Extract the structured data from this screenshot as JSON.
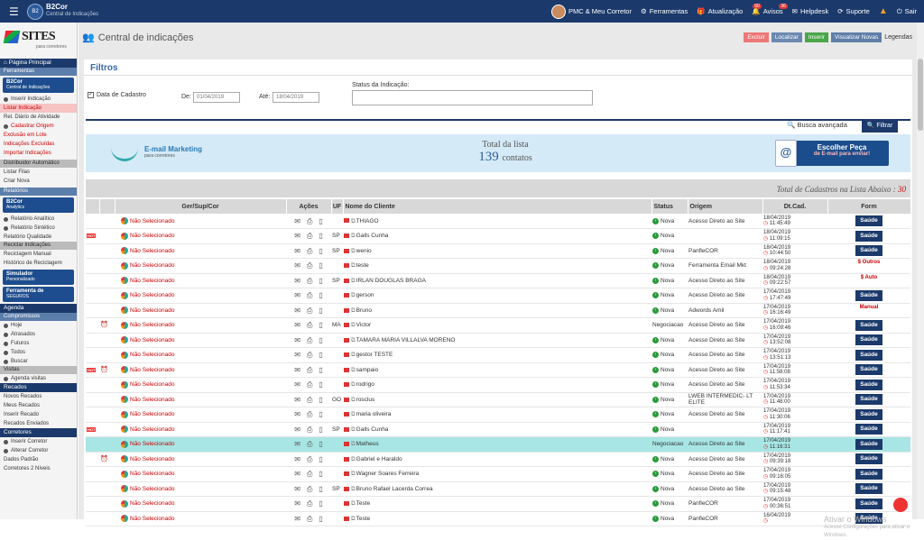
{
  "topbar": {
    "brand": "B2Cor",
    "brand_sub": "Central de Indicações",
    "user": "PMC & Meu Corretor",
    "ferramentas": "Ferramentas",
    "atualizacao": "Atualização",
    "atualizacao_badge": "60",
    "avisos": "Avisos",
    "avisos_badge": "36",
    "helpdesk": "Helpdesk",
    "suporte": "Suporte",
    "sair": "Sair"
  },
  "sidebar": {
    "logo": "SITES",
    "logo_sub": "para corretores",
    "pagina_principal": "Página Principal",
    "ferramentas": "Ferramentas",
    "b2cor_banner": "B2Cor",
    "b2cor_banner_sub": "Central de Indicações",
    "inserir": "Inserir Indicação",
    "listar": "Listar Indicação",
    "rel_diario": "Rel. Diário de Atividade",
    "cadastrar_origem": "Cadastrar Origem",
    "exclusao": "Exclusão em Lote",
    "excluidas": "Indicações Excluídas",
    "importar": "Importar Indicações",
    "distribuidor": "Distribuidor Automático",
    "listar_filas": "Listar Filas",
    "criar_nova": "Criar Nova",
    "relatorios": "Relatórios",
    "analytics": "B2Cor",
    "analytics_sub": "Analytics",
    "rel_analitico": "Relatório Analítico",
    "rel_sintetico": "Relatório Sintético",
    "rel_qualidade": "Relatório Qualidade",
    "reciclar": "Reciclar Indicações",
    "reciclagem_manual": "Reciclagem Manual",
    "historico": "Histórico de Reciclagem",
    "simulador": "Simulador",
    "simulador_sub": "Personalizado",
    "ferramenta_seguros": "Ferramenta de",
    "ferramenta_seguros_sub": "SEGUROS",
    "agenda": "Agenda",
    "compromissos": "Compromissos",
    "hoje": "Hoje",
    "atrasados": "Atrasados",
    "futuros": "Futuros",
    "todos": "Todos",
    "buscar": "Buscar",
    "visitas": "Visitas",
    "agenda_visitas": "Agenda visitas",
    "recados": "Recados",
    "novos_recados": "Novos Recados",
    "meus_recados": "Meus Recados",
    "inserir_recado": "Inserir Recado",
    "recados_enviados": "Recados Enviados",
    "corretores": "Corretores",
    "inserir_corretor": "Inserir Corretor",
    "alterar_corretor": "Alterar Corretor",
    "dados_padrao": "Dados Padrão",
    "corretores_niveis": "Corretores 2 Níveis"
  },
  "header": {
    "title": "Central de indicações",
    "excluir": "Excluir",
    "localizar": "Localizar",
    "inserir": "Inserir",
    "visualizar": "Visualizar Novas",
    "legendas": "Legendas"
  },
  "filters": {
    "title": "Filtros",
    "data_cadastro": "Data de Cadastro",
    "de": "De:",
    "de_value": "01/04/2019",
    "ate": "Até:",
    "ate_value": "18/04/2019",
    "status_label": "Status da Indicação:",
    "busca": "Busca avançada",
    "filtrar": "Filtrar"
  },
  "banner": {
    "email_mkt": "E-mail Marketing",
    "email_mkt_sub": "para corretores",
    "total_label": "Total da lista",
    "total_value": "139",
    "total_unit": "contatos",
    "escolher": "Escolher Peça",
    "escolher_sub": "de E-mail para enviar!"
  },
  "list": {
    "total_label": "Total de Cadastros na Lista Abaixo :",
    "total_value": "30"
  },
  "columns": [
    "Ger/Sup/Cor",
    "Ações",
    "UF",
    "Nome do Cliente",
    "Status",
    "Origem",
    "Dt.Cad.",
    "Form"
  ],
  "rows": [
    {
      "hot": false,
      "alarm": false,
      "gsc": "Não Selecionado",
      "uf": "",
      "name": "THIAGO",
      "status": "Nova",
      "origem": "Acesso Direto ao Site",
      "date": "18/04/2019",
      "time": "11:45:49",
      "form": "Saúde"
    },
    {
      "hot": true,
      "alarm": false,
      "gsc": "Não Selecionado",
      "uf": "SP",
      "name": "Galls Cunha",
      "status": "Nova",
      "origem": "",
      "date": "18/04/2019",
      "time": "11:09:15",
      "form": "Saúde"
    },
    {
      "hot": false,
      "alarm": false,
      "gsc": "Não Selecionado",
      "uf": "SP",
      "name": "wenio",
      "status": "Nova",
      "origem": "PanfleCOR",
      "date": "18/04/2019",
      "time": "10:44:50",
      "form": "Saúde"
    },
    {
      "hot": false,
      "alarm": false,
      "gsc": "Não Selecionado",
      "uf": "",
      "name": "teste",
      "status": "Nova",
      "origem": "Ferramenta Email Mkt",
      "date": "18/04/2019",
      "time": "09:24:28",
      "form": "$ Outros"
    },
    {
      "hot": false,
      "alarm": false,
      "gsc": "Não Selecionado",
      "uf": "SP",
      "name": "IRLAN DOUGLAS BRAGA",
      "status": "Nova",
      "origem": "Acesso Direto ao Site",
      "date": "18/04/2019",
      "time": "09:22:57",
      "form": "$ Auto"
    },
    {
      "hot": false,
      "alarm": false,
      "gsc": "Não Selecionado",
      "uf": "",
      "name": "gerson",
      "status": "Nova",
      "origem": "Acesso Direto ao Site",
      "date": "17/04/2019",
      "time": "17:47:49",
      "form": "Saúde"
    },
    {
      "hot": false,
      "alarm": false,
      "gsc": "Não Selecionado",
      "uf": "",
      "name": "Bruno",
      "status": "Nova",
      "origem": "Adwords Amil",
      "date": "17/04/2019",
      "time": "16:16:49",
      "form": "Manual"
    },
    {
      "hot": false,
      "alarm": true,
      "gsc": "Não Selecionado",
      "uf": "MA",
      "name": "Victor",
      "status": "Negociacao",
      "origem": "Acesso Direto ao Site",
      "date": "17/04/2019",
      "time": "16:09:46",
      "form": "Saúde"
    },
    {
      "hot": false,
      "alarm": false,
      "gsc": "Não Selecionado",
      "uf": "",
      "name": "TAMARA MARIA VILLALVA MORENO",
      "status": "Nova",
      "origem": "Acesso Direto ao Site",
      "date": "17/04/2019",
      "time": "13:52:08",
      "form": "Saúde"
    },
    {
      "hot": false,
      "alarm": false,
      "gsc": "Não Selecionado",
      "uf": "",
      "name": "gestor TESTE",
      "status": "Nova",
      "origem": "Acesso Direto ao Site",
      "date": "17/04/2019",
      "time": "13:51:13",
      "form": "Saúde"
    },
    {
      "hot": true,
      "alarm": true,
      "gsc": "Não Selecionado",
      "uf": "",
      "name": "sampaio",
      "status": "Nova",
      "origem": "Acesso Direto ao Site",
      "date": "17/04/2019",
      "time": "11:58:08",
      "form": "Saúde"
    },
    {
      "hot": false,
      "alarm": false,
      "gsc": "Não Selecionado",
      "uf": "",
      "name": "rodrigo",
      "status": "Nova",
      "origem": "Acesso Direto ao Site",
      "date": "17/04/2019",
      "time": "11:53:34",
      "form": "Saúde"
    },
    {
      "hot": false,
      "alarm": false,
      "gsc": "Não Selecionado",
      "uf": "GO",
      "name": "rosclus",
      "status": "Nova",
      "origem": "LWEB INTERMEDIC- LT ELITE",
      "date": "17/04/2019",
      "time": "11:48:00",
      "form": "Saúde"
    },
    {
      "hot": false,
      "alarm": false,
      "gsc": "Não Selecionado",
      "uf": "",
      "name": "maria oliveira",
      "status": "Nova",
      "origem": "Acesso Direto ao Site",
      "date": "17/04/2019",
      "time": "11:30:06",
      "form": "Saúde"
    },
    {
      "hot": true,
      "alarm": false,
      "gsc": "Não Selecionado",
      "uf": "SP",
      "name": "Galls Cunha",
      "status": "Nova",
      "origem": "",
      "date": "17/04/2019",
      "time": "11:17:41",
      "form": "Saúde"
    },
    {
      "hot": false,
      "alarm": false,
      "gsc": "Não Selecionado",
      "uf": "",
      "name": "Matheus",
      "status": "Negociacao",
      "origem": "Acesso Direto ao Site",
      "date": "17/04/2019",
      "time": "11:16:31",
      "form": "Saúde",
      "selected": true
    },
    {
      "hot": false,
      "alarm": true,
      "gsc": "Não Selecionado",
      "uf": "",
      "name": "Gabriel e Haraldo",
      "status": "Nova",
      "origem": "Acesso Direto ao Site",
      "date": "17/04/2019",
      "time": "09:39:18",
      "form": "Saúde"
    },
    {
      "hot": false,
      "alarm": false,
      "gsc": "Não Selecionado",
      "uf": "",
      "name": "Wagner Soares Ferreira",
      "status": "Nova",
      "origem": "Acesso Direto ao Site",
      "date": "17/04/2019",
      "time": "09:16:05",
      "form": "Saúde"
    },
    {
      "hot": false,
      "alarm": false,
      "gsc": "Não Selecionado",
      "uf": "SP",
      "name": "Bruno Rafael Lacerda Correa",
      "status": "Nova",
      "origem": "Acesso Direto ao Site",
      "date": "17/04/2019",
      "time": "09:15:48",
      "form": "Saúde"
    },
    {
      "hot": false,
      "alarm": false,
      "gsc": "Não Selecionado",
      "uf": "",
      "name": "Teste",
      "status": "Nova",
      "origem": "PanfleCOR",
      "date": "17/04/2019",
      "time": "00:36:51",
      "form": "Saúde"
    },
    {
      "hot": false,
      "alarm": false,
      "gsc": "Não Selecionado",
      "uf": "",
      "name": "Teste",
      "status": "Nova",
      "origem": "PanfleCOR",
      "date": "16/04/2019",
      "time": "",
      "form": "Saúde"
    }
  ],
  "watermark": {
    "line1": "Ativar o Windows",
    "line2": "Acesse Configurações para ativar o Windows."
  },
  "colors": {
    "navy": "#1b3a6b",
    "red_text": "#cc0000",
    "selected_row": "#a7e6e4"
  }
}
